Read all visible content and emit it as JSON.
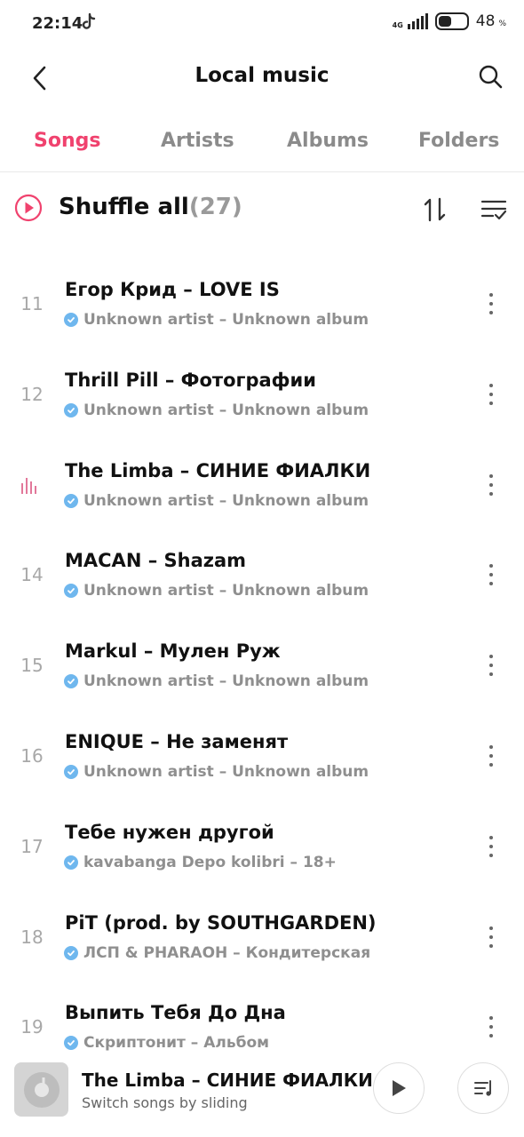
{
  "status": {
    "time": "22:14",
    "network": "4G",
    "battery_level": "48",
    "battery_unit": "%"
  },
  "header": {
    "title": "Local music",
    "back_icon": "chevron-left-icon",
    "search_icon": "search-icon"
  },
  "tabs": [
    {
      "label": "Songs",
      "active": true
    },
    {
      "label": "Artists",
      "active": false
    },
    {
      "label": "Albums",
      "active": false
    },
    {
      "label": "Folders",
      "active": false
    }
  ],
  "shuffle": {
    "label": "Shuffle all",
    "count": "(27)"
  },
  "songs": [
    {
      "num": "11",
      "title": "Егор Крид – LOVE IS",
      "subtitle": "Unknown artist – Unknown album",
      "playing": false
    },
    {
      "num": "12",
      "title": "Thrill Pill – Фотографии",
      "subtitle": "Unknown artist – Unknown album",
      "playing": false
    },
    {
      "num": "",
      "title": "The Limba – СИНИЕ ФИАЛКИ",
      "subtitle": "Unknown artist – Unknown album",
      "playing": true
    },
    {
      "num": "14",
      "title": "MACAN – Shazam",
      "subtitle": "Unknown artist – Unknown album",
      "playing": false
    },
    {
      "num": "15",
      "title": "Markul – Мулен Руж",
      "subtitle": "Unknown artist – Unknown album",
      "playing": false
    },
    {
      "num": "16",
      "title": "ENIQUE – Не заменят",
      "subtitle": "Unknown artist – Unknown album",
      "playing": false
    },
    {
      "num": "17",
      "title": "Тебе нужен  другой",
      "subtitle": "kavabanga Depo kolibri – 18+",
      "playing": false
    },
    {
      "num": "18",
      "title": "PiT (prod. by SOUTHGARDEN)",
      "subtitle": "ЛСП & PHARAOH – Кондитерская",
      "playing": false
    },
    {
      "num": "19",
      "title": "Выпить Тебя До Дна",
      "subtitle": "Скриптонит – Альбом",
      "playing": false
    }
  ],
  "player": {
    "title": "The Limba – СИНИЕ ФИАЛКИ",
    "hint": "Switch songs by sliding"
  },
  "colors": {
    "accent": "#f0426e",
    "verified": "#6fb7ee",
    "muted_text": "#8f8f8f"
  }
}
